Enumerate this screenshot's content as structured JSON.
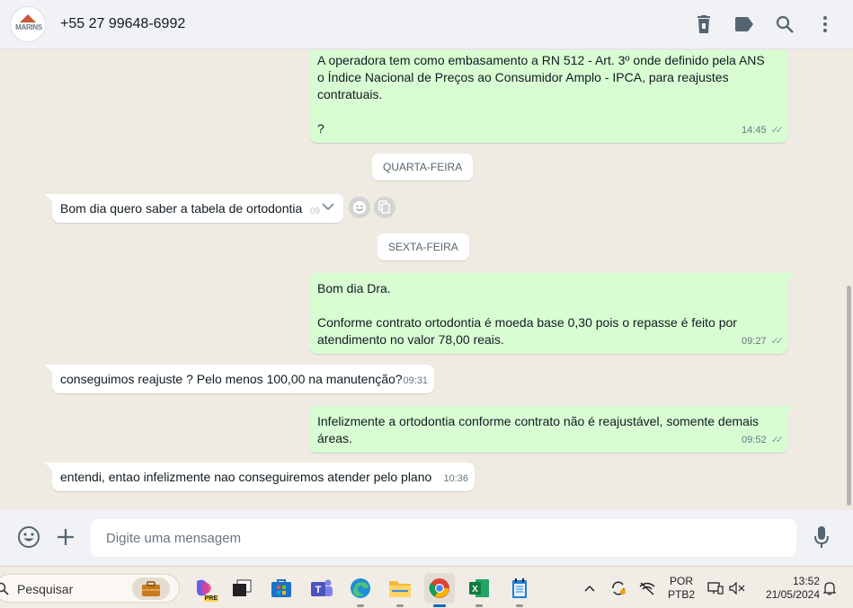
{
  "header": {
    "avatar_text": "MARINS",
    "contact": "+55 27 99648-6992",
    "icons": [
      "trash-icon",
      "label-icon",
      "search-icon",
      "more-vertical-icon"
    ]
  },
  "messages": [
    {
      "dir": "out",
      "text": "A operadora tem como embasamento a RN 512 - Art. 3º onde definido pela ANS\no Índice Nacional de Preços ao Consumidor Amplo - IPCA, para reajustes\ncontratuais.\n\n?",
      "time": "14:45"
    },
    {
      "dir": "day",
      "text": "QUARTA-FEIRA"
    },
    {
      "dir": "in",
      "text": "Bom dia quero saber a tabela de ortodontia",
      "time": "09"
    },
    {
      "dir": "day",
      "text": "SEXTA-FEIRA"
    },
    {
      "dir": "out",
      "text": "Bom dia Dra.\n\nConforme contrato ortodontia é moeda base 0,30 pois o repasse é feito por\natendimento no valor 78,00 reais.",
      "time": "09:27"
    },
    {
      "dir": "in",
      "text": "conseguimos reajuste ? Pelo menos 100,00 na manutenção?",
      "time": "09:31"
    },
    {
      "dir": "out",
      "text": "Infelizmente a ortodontia conforme contrato não é reajustável, somente demais\náreas.",
      "time": "09:52"
    },
    {
      "dir": "in",
      "text": "entendi, entao infelizmente nao conseguiremos atender pelo plano",
      "time": "10:36"
    }
  ],
  "composer": {
    "placeholder": "Digite uma mensagem"
  },
  "taskbar": {
    "search_label": "Pesquisar",
    "lang_top": "POR",
    "lang_bottom": "PTB2",
    "time": "13:52",
    "date": "21/05/2024",
    "copilot_badge": "PRE"
  },
  "colors": {
    "outgoing": "#d9fdd3",
    "incoming": "#ffffff",
    "background": "#efeae2"
  }
}
